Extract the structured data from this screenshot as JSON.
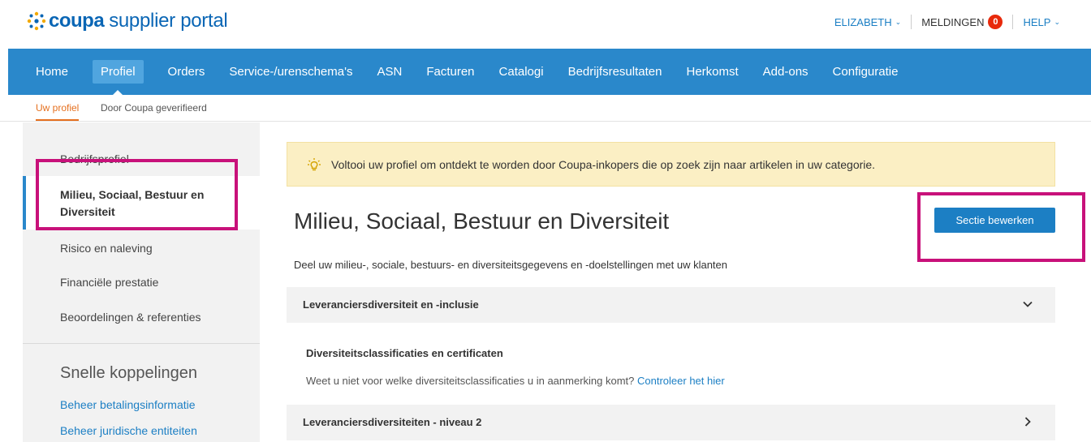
{
  "header": {
    "logo_brand": "coupa",
    "logo_rest": "supplier portal",
    "user_label": "ELIZABETH",
    "notifications_label": "MELDINGEN",
    "notifications_count": "0",
    "help_label": "HELP"
  },
  "nav": {
    "items": [
      {
        "label": "Home"
      },
      {
        "label": "Profiel"
      },
      {
        "label": "Orders"
      },
      {
        "label": "Service-/urenschema's"
      },
      {
        "label": "ASN"
      },
      {
        "label": "Facturen"
      },
      {
        "label": "Catalogi"
      },
      {
        "label": "Bedrijfsresultaten"
      },
      {
        "label": "Herkomst"
      },
      {
        "label": "Add-ons"
      },
      {
        "label": "Configuratie"
      }
    ],
    "active_index": 1
  },
  "subnav": {
    "tabs": [
      {
        "label": "Uw profiel"
      },
      {
        "label": "Door Coupa geverifieerd"
      }
    ]
  },
  "sidebar": {
    "items": [
      {
        "label": "Bedrijfsprofiel"
      },
      {
        "label": "Milieu, Sociaal, Bestuur en Diversiteit"
      },
      {
        "label": "Risico en naleving"
      },
      {
        "label": "Financiële prestatie"
      },
      {
        "label": "Beoordelingen & referenties"
      }
    ],
    "quick_links_title": "Snelle koppelingen",
    "quick_links": [
      {
        "label": "Beheer betalingsinformatie"
      },
      {
        "label": "Beheer juridische entiteiten"
      }
    ]
  },
  "main": {
    "banner_text": "Voltooi uw profiel om ontdekt te worden door Coupa-inkopers die op zoek zijn naar artikelen in uw categorie.",
    "title": "Milieu, Sociaal, Bestuur en Diversiteit",
    "edit_button_label": "Sectie bewerken",
    "description": "Deel uw milieu-, sociale, bestuurs- en diversiteitsgegevens en -doelstellingen met uw klanten",
    "accordions": [
      {
        "title": "Leveranciersdiversiteit en -inclusie",
        "state": "expanded"
      },
      {
        "title": "Leveranciersdiversiteiten - niveau 2",
        "state": "collapsed"
      }
    ],
    "subsection_title": "Diversiteitsclassificaties en certificaten",
    "hint_text": "Weet u niet voor welke diversiteitsclassificaties u in aanmerking komt?",
    "hint_link": "Controleer het hier"
  },
  "colors": {
    "brand_blue": "#2a88cb",
    "link_blue": "#1c7fc4",
    "active_tab_orange": "#e5701f",
    "highlight_magenta": "#c8117a",
    "badge_red": "#e8290b",
    "banner_bg": "#fbefc4"
  }
}
